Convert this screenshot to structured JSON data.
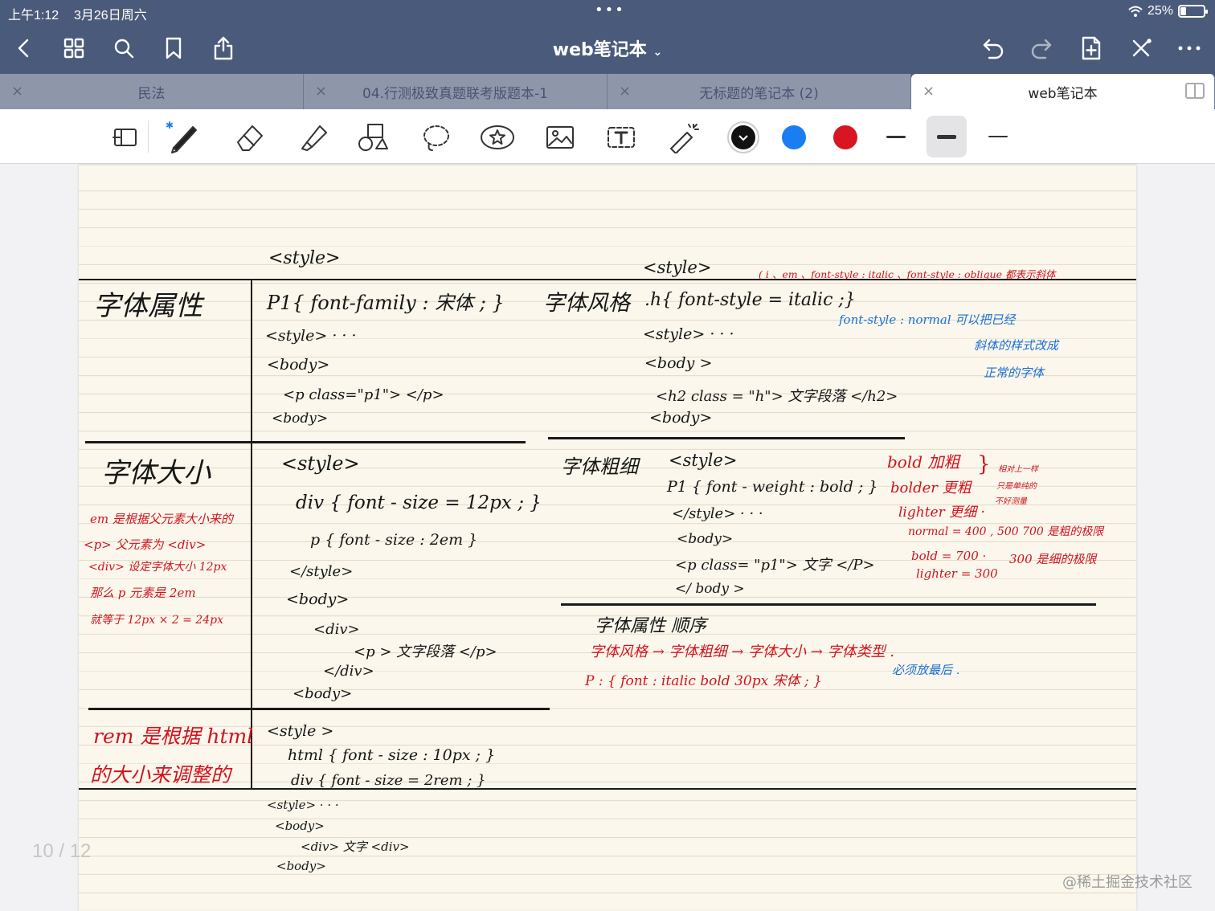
{
  "status": {
    "time": "上午1:12",
    "date": "3月26日周六",
    "battery": "25%",
    "battery_level": 0.25
  },
  "nav": {
    "title": "web笔记本",
    "title_chevron": "chevron-down-icon",
    "left_icons": [
      "back-chevron-icon",
      "grid-icon",
      "search-icon",
      "bookmark-icon",
      "share-icon"
    ],
    "right_icons": [
      "undo-icon",
      "redo-icon",
      "add-page-icon",
      "close-x-icon",
      "more-icon"
    ]
  },
  "tabs": [
    {
      "label": "民法"
    },
    {
      "label": "04.行测极致真题联考版题本-1"
    },
    {
      "label": "无标题的笔记本 (2)"
    },
    {
      "label": "web笔记本",
      "active": true
    }
  ],
  "toolbar": {
    "tools": [
      "lasso-page-icon",
      "pen-icon",
      "eraser-icon",
      "highlighter-icon",
      "shapes-icon",
      "lasso-icon",
      "sticker-icon",
      "image-icon",
      "text-icon",
      "laser-pointer-icon"
    ],
    "colors": [
      "#111111",
      "#1a7ef2",
      "#d81520"
    ],
    "selected_color": "#111111",
    "thickness": [
      "thin",
      "medium",
      "thick"
    ],
    "selected_thickness": "medium"
  },
  "notes": {
    "s1_heading": "字体属性",
    "s1_code": [
      "<style>",
      "P1{ font-family : 宋体 ; }",
      "<style> · · ·",
      "<body>",
      "<p class=\"p1\"> </p>",
      "<body>"
    ],
    "s2_heading": "字体风格",
    "s2_code": [
      "<style>",
      ".h{ font-style = italic ;}",
      "<style> · · ·",
      "<body >",
      "<h2 class = \"h\"> 文字段落 </h2>",
      "<body>"
    ],
    "s2_red": "( i 、em 、font-style : italic 、font-style : oblique 都表示斜体",
    "s2_blue": [
      "font-style : normal  可以把已经",
      "斜体的样式改成",
      "正常的字体"
    ],
    "s3_heading": "字体大小",
    "s3_code": [
      "<style>",
      "div { font - size = 12px ; }",
      "p { font - size : 2em }",
      "</style>",
      "<body>",
      "<div>",
      "<p > 文字段落 </p>",
      "</div>",
      "<body>"
    ],
    "s3_red": [
      "em 是根据父元素大小来的",
      "<p> 父元素为 <div>",
      "<div> 设定字体大小 12px",
      "那么 p 元素是 2em",
      "就等于 12px × 2 = 24px"
    ],
    "s4_heading": "字体粗细",
    "s4_code": [
      "<style>",
      "P1 { font - weight : bold ; }",
      "</style> · · ·",
      "<body>",
      "<p class= \"p1\"> 文字 </P>",
      "</ body >"
    ],
    "s4_red": [
      "bold  加粗",
      "bolder  更粗",
      "lighter  更细 ·",
      "normal = 400 , 500  700 是粗的极限",
      "bold = 700 ·",
      "lighter = 300",
      "300 是细的极限"
    ],
    "s4_brace_notes": [
      "相对上一样",
      "只是单纯的",
      "不好测量"
    ],
    "s5_heading": "字体属性 顺序",
    "s5_red": [
      "字体风格 → 字体粗细 → 字体大小 → 字体类型 .",
      "P : { font : italic   bold   30px   宋体 ; }"
    ],
    "s5_blue": "必须放最后 .",
    "s6_red": [
      "rem 是根据 html",
      "的大小来调整的"
    ],
    "s6_code": [
      "<style >",
      "html { font - size : 10px ; }",
      "div { font - size = 2rem ; }",
      "<style> · · ·",
      "<body>",
      "<div> 文字 <div>",
      "<body>"
    ]
  },
  "page_counter": "10 / 12",
  "watermark": "@稀土掘金技术社区"
}
